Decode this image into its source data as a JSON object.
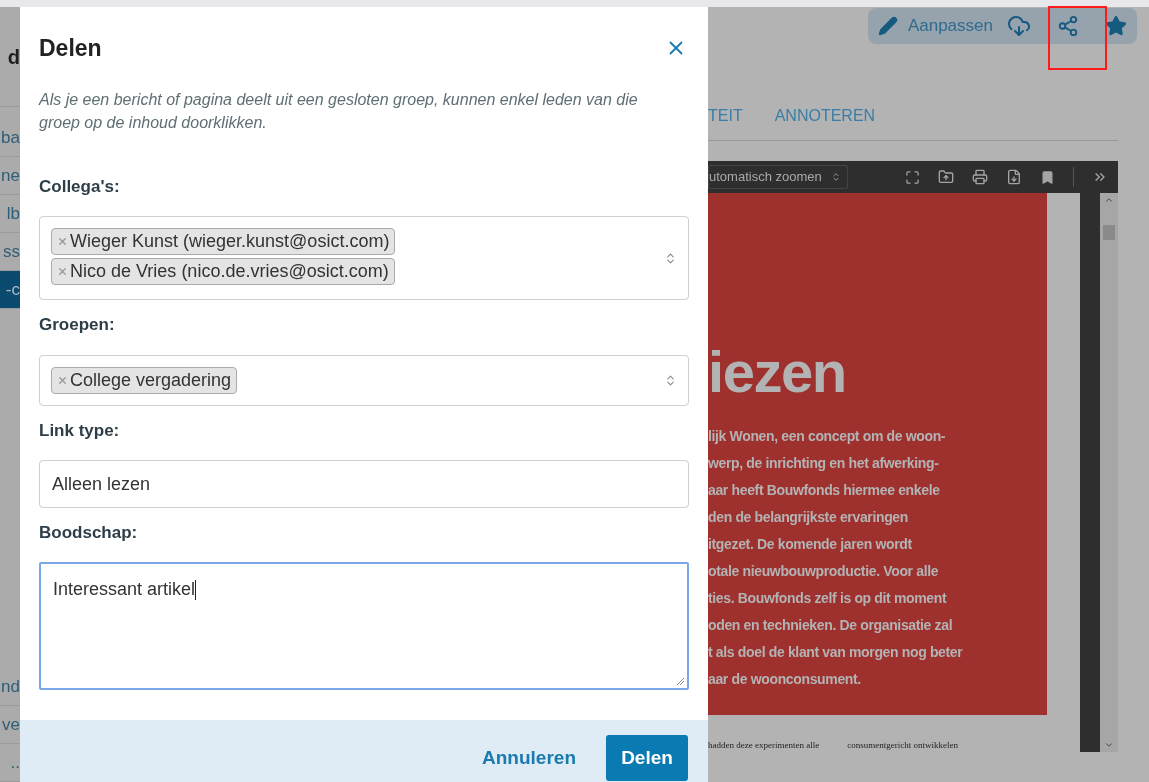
{
  "sidebar": {
    "title": "d",
    "items": [
      {
        "label": "ba",
        "selected": false
      },
      {
        "label": "ne",
        "selected": false
      },
      {
        "label": "lb",
        "selected": false
      },
      {
        "label": "ss",
        "selected": false
      },
      {
        "label": "-c",
        "selected": true
      }
    ],
    "bottom_items": [
      {
        "label": "nd",
        "selected": false
      },
      {
        "label": "ve",
        "selected": false
      },
      {
        "label": "..",
        "selected": false
      }
    ]
  },
  "toolbar": {
    "edit_label": "Aanpassen"
  },
  "tabs": [
    {
      "label": "TEIT"
    },
    {
      "label": "ANNOTEREN"
    }
  ],
  "viewer": {
    "zoom": "utomatisch zoomen",
    "heading": "iezen",
    "paragraph": [
      "lijk Wonen, een concept om de woon-",
      "werp, de inrichting en het afwerking-",
      "aar heeft Bouwfonds hiermee enkele",
      "den de belangrijkste ervaringen",
      "itgezet. De komende jaren wordt",
      "otale nieuwbouwproductie. Voor alle",
      "ties. Bouwfonds zelf is op dit moment",
      "oden en technieken. De organisatie zal",
      "t als doel de klant van morgen nog beter",
      "aar de woonconsument."
    ],
    "footer": [
      "hadden deze experimenten alle",
      "consumentgericht ontwikkelen"
    ]
  },
  "dialog": {
    "title": "Delen",
    "note": "Als je een bericht of pagina deelt uit een gesloten groep, kunnen enkel leden van die groep op de inhoud doorklikken.",
    "colleagues": {
      "label": "Collega's:",
      "chips": [
        "Wieger Kunst (wieger.kunst@osict.com)",
        "Nico de Vries (nico.de.vries@osict.com)"
      ]
    },
    "groups": {
      "label": "Groepen:",
      "chips": [
        "College vergadering"
      ]
    },
    "link_type": {
      "label": "Link type:",
      "value": "Alleen lezen"
    },
    "message": {
      "label": "Boodschap:",
      "value": "Interessant artikel",
      "focused": true
    },
    "buttons": {
      "cancel": "Annuleren",
      "submit": "Delen"
    }
  }
}
